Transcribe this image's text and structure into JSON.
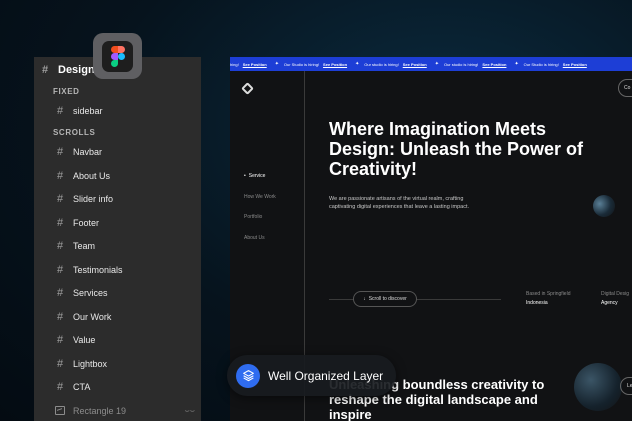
{
  "panel": {
    "title": "Design",
    "sections": [
      {
        "label": "FIXED",
        "items": [
          "sidebar"
        ]
      },
      {
        "label": "SCROLLS",
        "items": [
          "Navbar",
          "About Us",
          "Slider info",
          "Footer",
          "Team",
          "Testimonials",
          "Services",
          "Our Work",
          "Value",
          "Lightbox",
          "CTA"
        ]
      }
    ],
    "last_item": "Rectangle 19"
  },
  "ticker": {
    "items": [
      {
        "text": "hing!",
        "link": "See Position"
      },
      {
        "text": "Our Studio is hiring!",
        "link": "See Position"
      },
      {
        "text": "Our studio is hiring!",
        "link": "See Position"
      },
      {
        "text": "Our studio is hiring!",
        "link": "See Position"
      },
      {
        "text": "Our Studio is hiring!",
        "link": "See Position"
      }
    ]
  },
  "site": {
    "nav": [
      "Service",
      "How We Work",
      "Portfolio",
      "About Us"
    ],
    "hero_title": "Where Imagination Meets Design: Unleash the Power of Creativity!",
    "hero_desc": "We are passionate artisans of the virtual realm, crafting captivating digital experiences that leave a lasting impact.",
    "scroll_label": "Scroll to discover",
    "based_label": "Based in Springfield",
    "based_value": "Indonesia",
    "digital_label": "Digital Desig",
    "digital_value": "Agency",
    "corner_top": "Co",
    "corner_bottom": "Le",
    "hero2": "Unleashing boundless creativity to reshape the digital landscape and inspire"
  },
  "pill": {
    "label": "Well Organized Layer"
  },
  "colors": {
    "accent": "#2f6cf0",
    "ticker": "#1d3ed6",
    "panel": "#2c2c2c"
  }
}
